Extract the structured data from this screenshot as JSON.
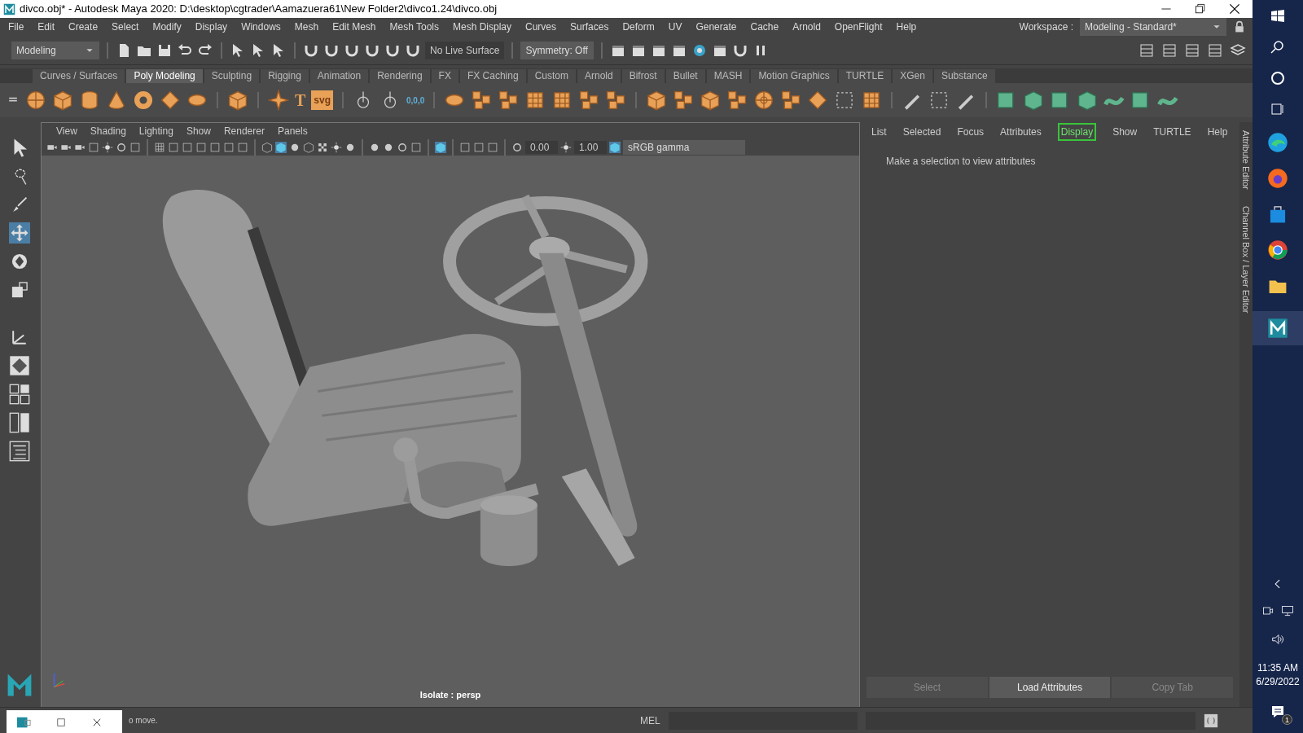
{
  "window": {
    "title": "divco.obj* - Autodesk Maya 2020: D:\\desktop\\cgtrader\\Aamazuera61\\New Folder2\\divco1.24\\divco.obj"
  },
  "menu": [
    "File",
    "Edit",
    "Create",
    "Select",
    "Modify",
    "Display",
    "Windows",
    "Mesh",
    "Edit Mesh",
    "Mesh Tools",
    "Mesh Display",
    "Curves",
    "Surfaces",
    "Deform",
    "UV",
    "Generate",
    "Cache",
    "Arnold",
    "OpenFlight",
    "Help"
  ],
  "workspace": {
    "label": "Workspace :",
    "value": "Modeling - Standard*"
  },
  "toolbar": {
    "mode": "Modeling",
    "live_surface": "No Live Surface",
    "symmetry": "Symmetry: Off"
  },
  "shelf_tabs": [
    {
      "label": "Curves / Surfaces",
      "selected": false
    },
    {
      "label": "Poly Modeling",
      "selected": true
    },
    {
      "label": "Sculpting",
      "selected": false
    },
    {
      "label": "Rigging",
      "selected": false
    },
    {
      "label": "Animation",
      "selected": false
    },
    {
      "label": "Rendering",
      "selected": false
    },
    {
      "label": "FX",
      "selected": false
    },
    {
      "label": "FX Caching",
      "selected": false
    },
    {
      "label": "Custom",
      "selected": false
    },
    {
      "label": "Arnold",
      "selected": false
    },
    {
      "label": "Bifrost",
      "selected": false
    },
    {
      "label": "Bullet",
      "selected": false
    },
    {
      "label": "MASH",
      "selected": false
    },
    {
      "label": "Motion Graphics",
      "selected": false
    },
    {
      "label": "TURTLE",
      "selected": false
    },
    {
      "label": "XGen",
      "selected": false
    },
    {
      "label": "Substance",
      "selected": false
    }
  ],
  "shelf_texts": [
    "T",
    "svg",
    "0,0,0"
  ],
  "viewport": {
    "menu": [
      "View",
      "Shading",
      "Lighting",
      "Show",
      "Renderer",
      "Panels"
    ],
    "exposure": "0.00",
    "gamma": "1.00",
    "color_space": "sRGB gamma",
    "camera_label": "Isolate : persp"
  },
  "attribute_editor": {
    "menu": [
      {
        "label": "List",
        "selected": false
      },
      {
        "label": "Selected",
        "selected": false
      },
      {
        "label": "Focus",
        "selected": false
      },
      {
        "label": "Attributes",
        "selected": false
      },
      {
        "label": "Display",
        "selected": true
      },
      {
        "label": "Show",
        "selected": false
      },
      {
        "label": "TURTLE",
        "selected": false
      },
      {
        "label": "Help",
        "selected": false
      }
    ],
    "message": "Make a selection to view attributes",
    "buttons": [
      {
        "label": "Select",
        "disabled": true
      },
      {
        "label": "Load Attributes",
        "disabled": false
      },
      {
        "label": "Copy Tab",
        "disabled": true
      }
    ],
    "side_tabs": [
      "Attribute Editor",
      "Channel Box / Layer Editor"
    ]
  },
  "status": {
    "help_line": "o move.",
    "command_language": "MEL"
  },
  "taskbar": {
    "time": "11:35 AM",
    "date": "6/29/2022",
    "notifications": "1"
  }
}
